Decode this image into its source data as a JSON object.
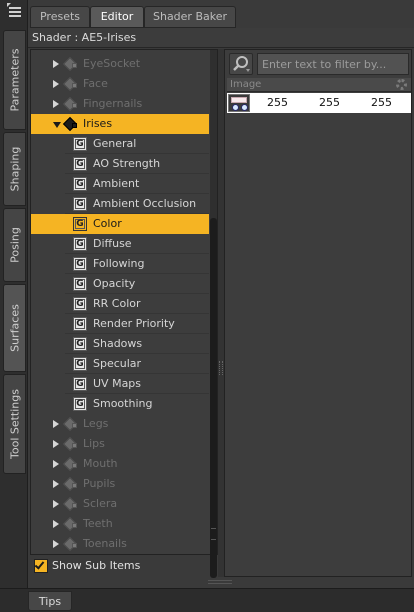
{
  "left_tabs": [
    "Parameters",
    "Shaping",
    "Posing",
    "Surfaces",
    "Tool Settings"
  ],
  "active_left_tab": "Surfaces",
  "top_tabs": [
    "Presets",
    "Editor",
    "Shader Baker"
  ],
  "active_top_tab": "Editor",
  "shader_title": "Shader : AE5-Irises",
  "tree": {
    "folders_above": [
      "EyeSocket",
      "Face",
      "Fingernails"
    ],
    "selected_folder": "Irises",
    "properties": [
      "General",
      "AO Strength",
      "Ambient",
      "Ambient Occlusion",
      "Color",
      "Diffuse",
      "Following",
      "Opacity",
      "RR Color",
      "Render Priority",
      "Shadows",
      "Specular",
      "UV Maps",
      "Smoothing"
    ],
    "selected_property": "Color",
    "folders_below": [
      "Legs",
      "Lips",
      "Mouth",
      "Pupils",
      "Sclera",
      "Teeth",
      "Toenails"
    ]
  },
  "show_sub_items": {
    "label": "Show Sub Items",
    "checked": true
  },
  "search": {
    "placeholder": "Enter text to filter by..."
  },
  "property_panel": {
    "header_label": "Image",
    "values": [
      "255",
      "255",
      "255"
    ]
  },
  "bottom": {
    "tips_label": "Tips"
  },
  "colors": {
    "accent": "#f5b423",
    "background": "#3a3a3a",
    "panel": "#3d3d3d"
  },
  "icons": {
    "menu": "menu-icon",
    "search": "search-icon",
    "gear": "gear-icon",
    "folder": "surface-group-icon",
    "property": "property-group-icon"
  }
}
